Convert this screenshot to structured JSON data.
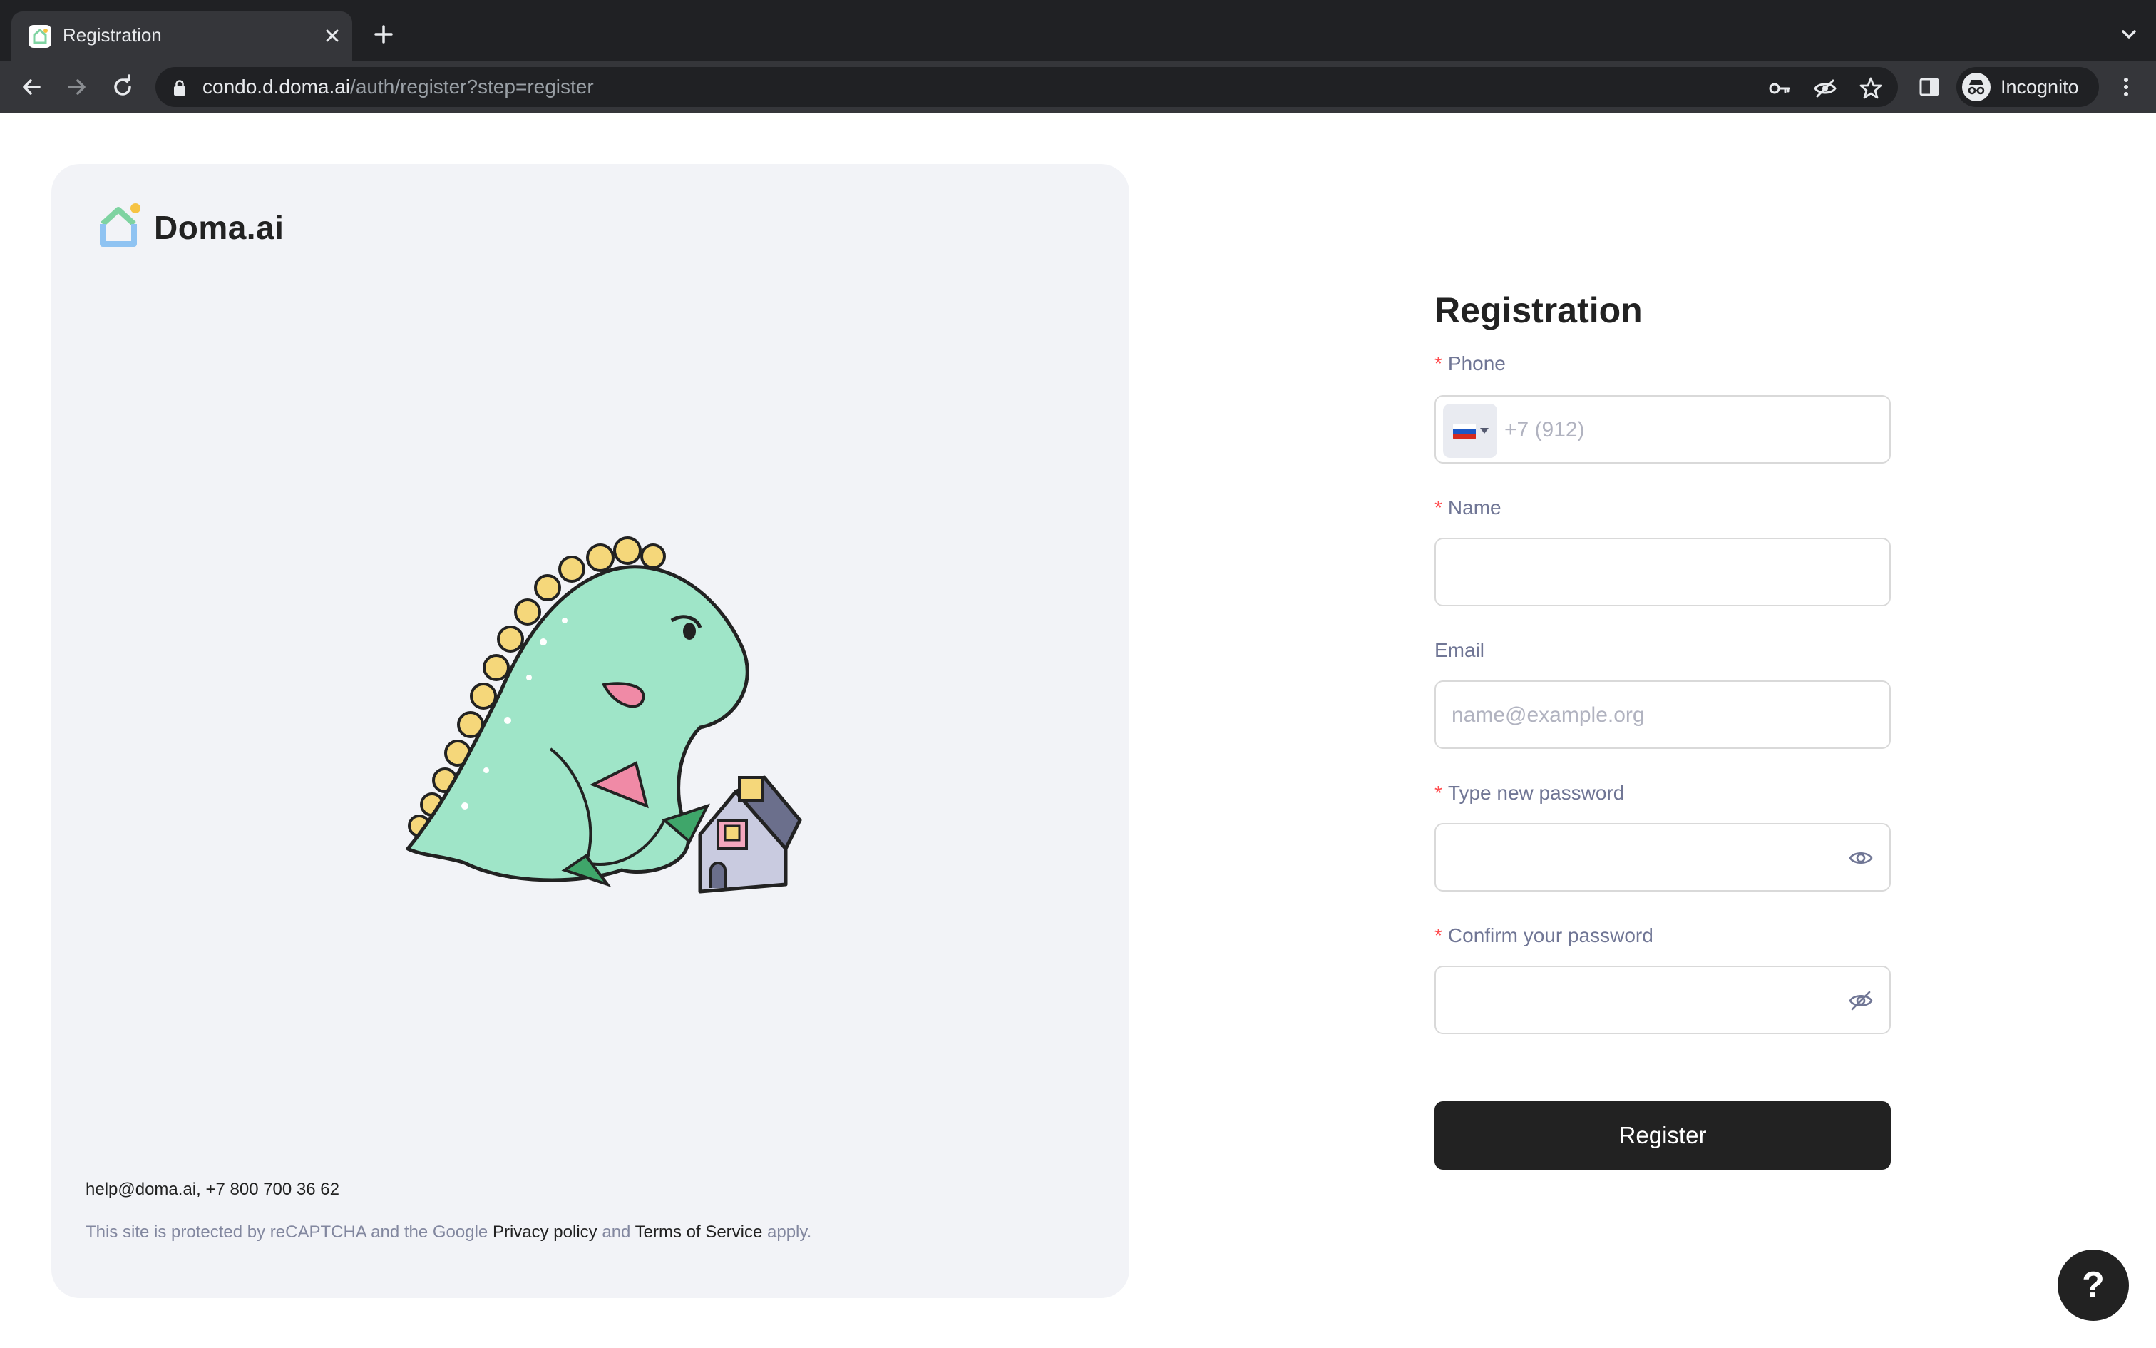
{
  "browser": {
    "tab_title": "Registration",
    "url_host": "condo.d.doma.ai",
    "url_path": "/auth/register?step=register",
    "profile_label": "Incognito"
  },
  "brand": {
    "name": "Doma.ai",
    "colors": {
      "logo_green": "#7ed3a1",
      "logo_blue": "#8fc3f2",
      "logo_dot": "#f6c343"
    }
  },
  "left_panel": {
    "contact_email": "help@doma.ai",
    "contact_separator": ",",
    "contact_phone": "+7 800 700 36 62",
    "recaptcha_prefix": "This site is protected by reCAPTCHA and the Google",
    "privacy_link": "Privacy policy",
    "and_word": "and",
    "terms_link": "Terms of Service",
    "recaptcha_suffix": "apply."
  },
  "form": {
    "title": "Registration",
    "required_mark": "*",
    "phone": {
      "label": "Phone",
      "placeholder": "+7 (912)",
      "country": "ru-flag"
    },
    "name": {
      "label": "Name",
      "value": ""
    },
    "email": {
      "label": "Email",
      "placeholder": "name@example.org"
    },
    "password": {
      "label": "Type new password",
      "value": "",
      "toggle_icon": "eye-icon"
    },
    "confirm_password": {
      "label": "Confirm your password",
      "value": "",
      "toggle_icon": "eye-off-icon"
    },
    "submit_label": "Register"
  },
  "help": {
    "label": "?"
  },
  "colors": {
    "primary_button": "#222222",
    "required": "#ff4d4f",
    "label": "#707695",
    "panel_bg": "#f2f3f7"
  }
}
